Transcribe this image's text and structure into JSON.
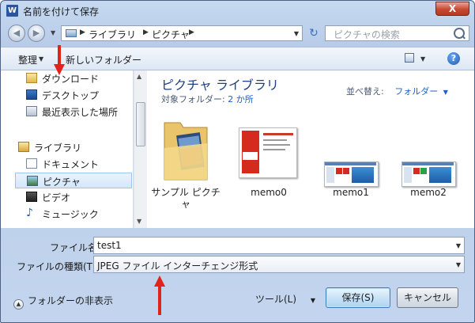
{
  "window": {
    "title": "名前を付けて保存",
    "app_icon_letter": "W",
    "close_label": "X"
  },
  "address": {
    "crumbs": [
      "ライブラリ",
      "ピクチャ"
    ],
    "search_placeholder": "ピクチャの検索"
  },
  "toolbar": {
    "organize_label": "整理",
    "new_folder_label": "新しいフォルダー",
    "help_label": "?"
  },
  "nav": {
    "items": [
      {
        "label": "ダウンロード",
        "icon": "download-folder-icon"
      },
      {
        "label": "デスクトップ",
        "icon": "desktop-icon"
      },
      {
        "label": "最近表示した場所",
        "icon": "recent-places-icon"
      },
      {
        "label": "ライブラリ",
        "icon": "libraries-icon"
      },
      {
        "label": "ドキュメント",
        "icon": "documents-icon"
      },
      {
        "label": "ピクチャ",
        "icon": "pictures-icon",
        "selected": true
      },
      {
        "label": "ビデオ",
        "icon": "videos-icon"
      },
      {
        "label": "ミュージック",
        "icon": "music-icon"
      }
    ]
  },
  "content": {
    "library_title": "ピクチャ ライブラリ",
    "target_folder_label": "対象フォルダー:",
    "target_folder_link": "2 か所",
    "sort_label": "並べ替え:",
    "sort_value": "フォルダー",
    "files": [
      {
        "name": "サンプル ピクチャ",
        "kind": "folder"
      },
      {
        "name": "memo0",
        "kind": "image"
      },
      {
        "name": "memo1",
        "kind": "image"
      },
      {
        "name": "memo2",
        "kind": "image"
      }
    ]
  },
  "form": {
    "filename_label": "ファイル名(N):",
    "filename_value": "test1",
    "filetype_label": "ファイルの種類(T):",
    "filetype_value": "JPEG ファイル インターチェンジ形式",
    "hide_folders_label": "フォルダーの非表示",
    "tools_label": "ツール(L)",
    "save_label": "保存(S)",
    "cancel_label": "キャンセル"
  },
  "colors": {
    "annotation_arrow": "#e0231b",
    "library_title": "#1e3f80",
    "link": "#1f5fc2"
  }
}
